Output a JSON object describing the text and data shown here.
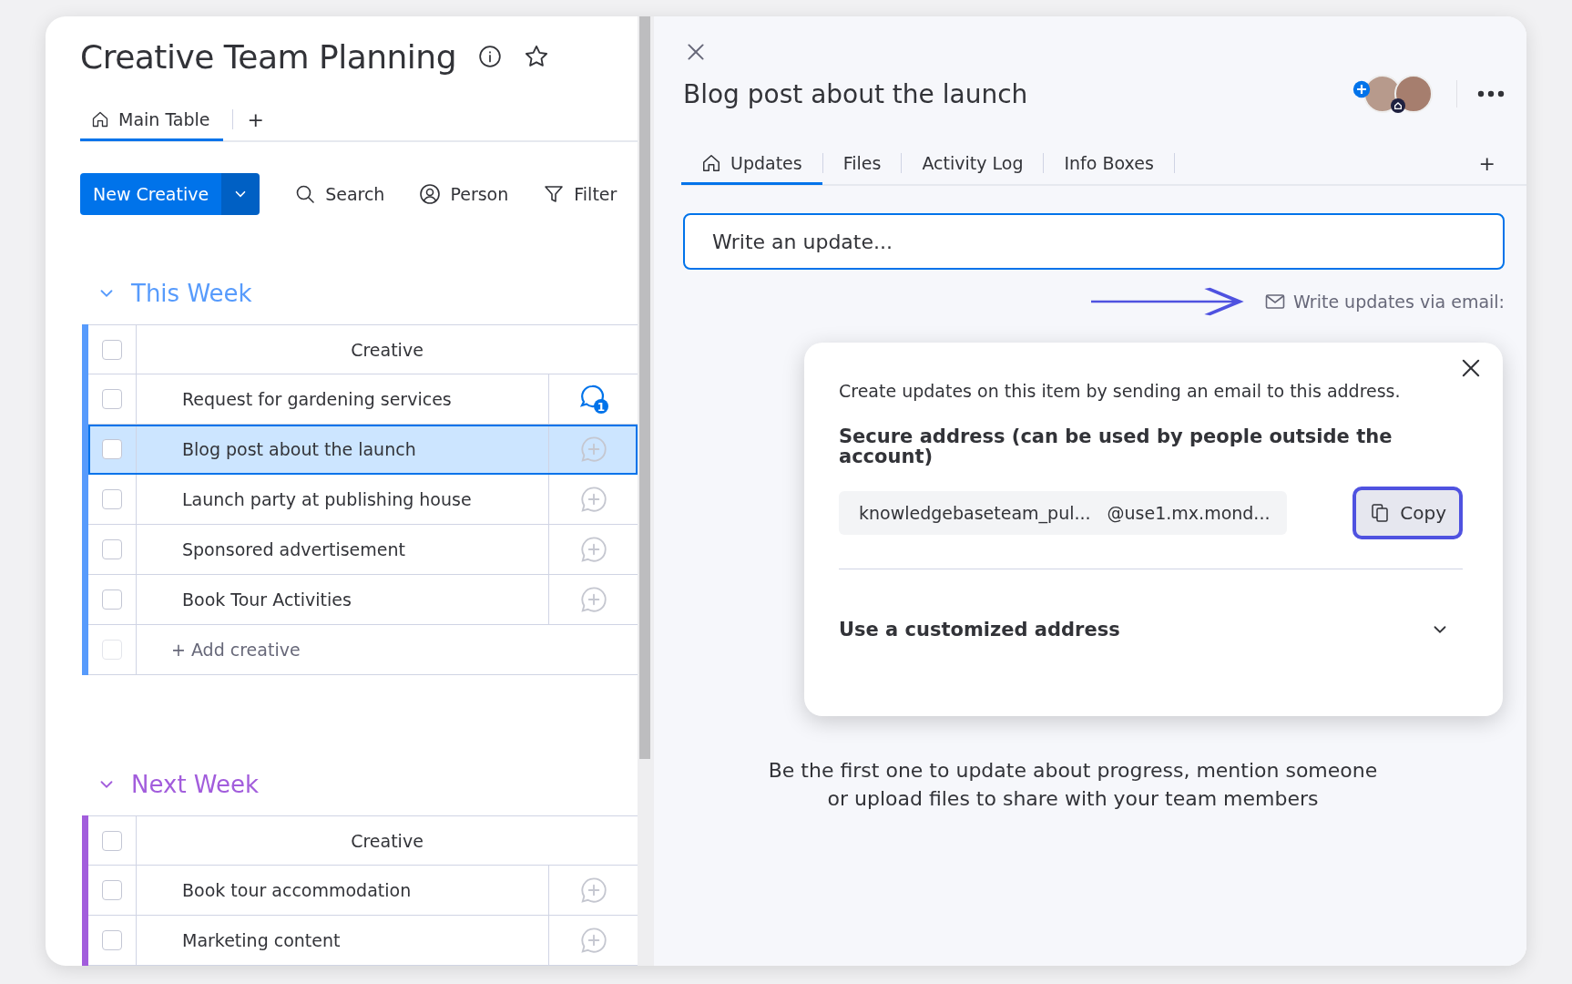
{
  "board": {
    "title": "Creative Team Planning",
    "views": [
      {
        "label": "Main Table",
        "selected": true
      }
    ],
    "add_view": "+",
    "primary_button": "New Creative",
    "toolbar": [
      "Search",
      "Person",
      "Filter"
    ]
  },
  "groups": [
    {
      "title": "This Week",
      "color": "#579bfc",
      "expanded": true,
      "column": "Creative",
      "header_checked": false,
      "add_row": {
        "label": "+ Add creative",
        "checked": false
      },
      "rows": [
        {
          "name": "Request for gardening services",
          "selected": false,
          "checked": false,
          "updates_count": "1"
        },
        {
          "name": "Blog post about the launch",
          "selected": true,
          "checked": false
        },
        {
          "name": "Launch party at publishing house",
          "selected": false,
          "checked": false
        },
        {
          "name": "Sponsored advertisement",
          "selected": false,
          "checked": false
        },
        {
          "name": "Book Tour Activities",
          "selected": false,
          "checked": false
        }
      ]
    },
    {
      "title": "Next Week",
      "color": "#a25ddc",
      "expanded": true,
      "column": "Creative",
      "header_checked": false,
      "rows": [
        {
          "name": "Book tour accommodation",
          "selected": false,
          "checked": false
        },
        {
          "name": "Marketing content",
          "selected": false,
          "checked": false
        }
      ]
    }
  ],
  "item_panel": {
    "title": "Blog post about the launch",
    "tabs": [
      {
        "label": "Updates",
        "selected": true
      },
      {
        "label": "Files",
        "selected": false
      },
      {
        "label": "Activity Log",
        "selected": false
      },
      {
        "label": "Info Boxes",
        "selected": false
      }
    ],
    "add_tab": "+",
    "update_field": {
      "placeholder": "Write an update..."
    },
    "email_link": "Write updates via email:",
    "email_popover": {
      "intro": "Create updates on this item by sending an email to this address.",
      "heading": "Secure address (can be used by people outside the account)",
      "address_user": "knowledgebaseteam_pul...",
      "address_domain": "@use1.mx.mond...",
      "copy_button": "Copy",
      "custom_section": "Use a customized address",
      "custom_expanded": false
    },
    "empty_text": "Be the first one to update about progress, mention someone or upload files to share with your team members"
  }
}
